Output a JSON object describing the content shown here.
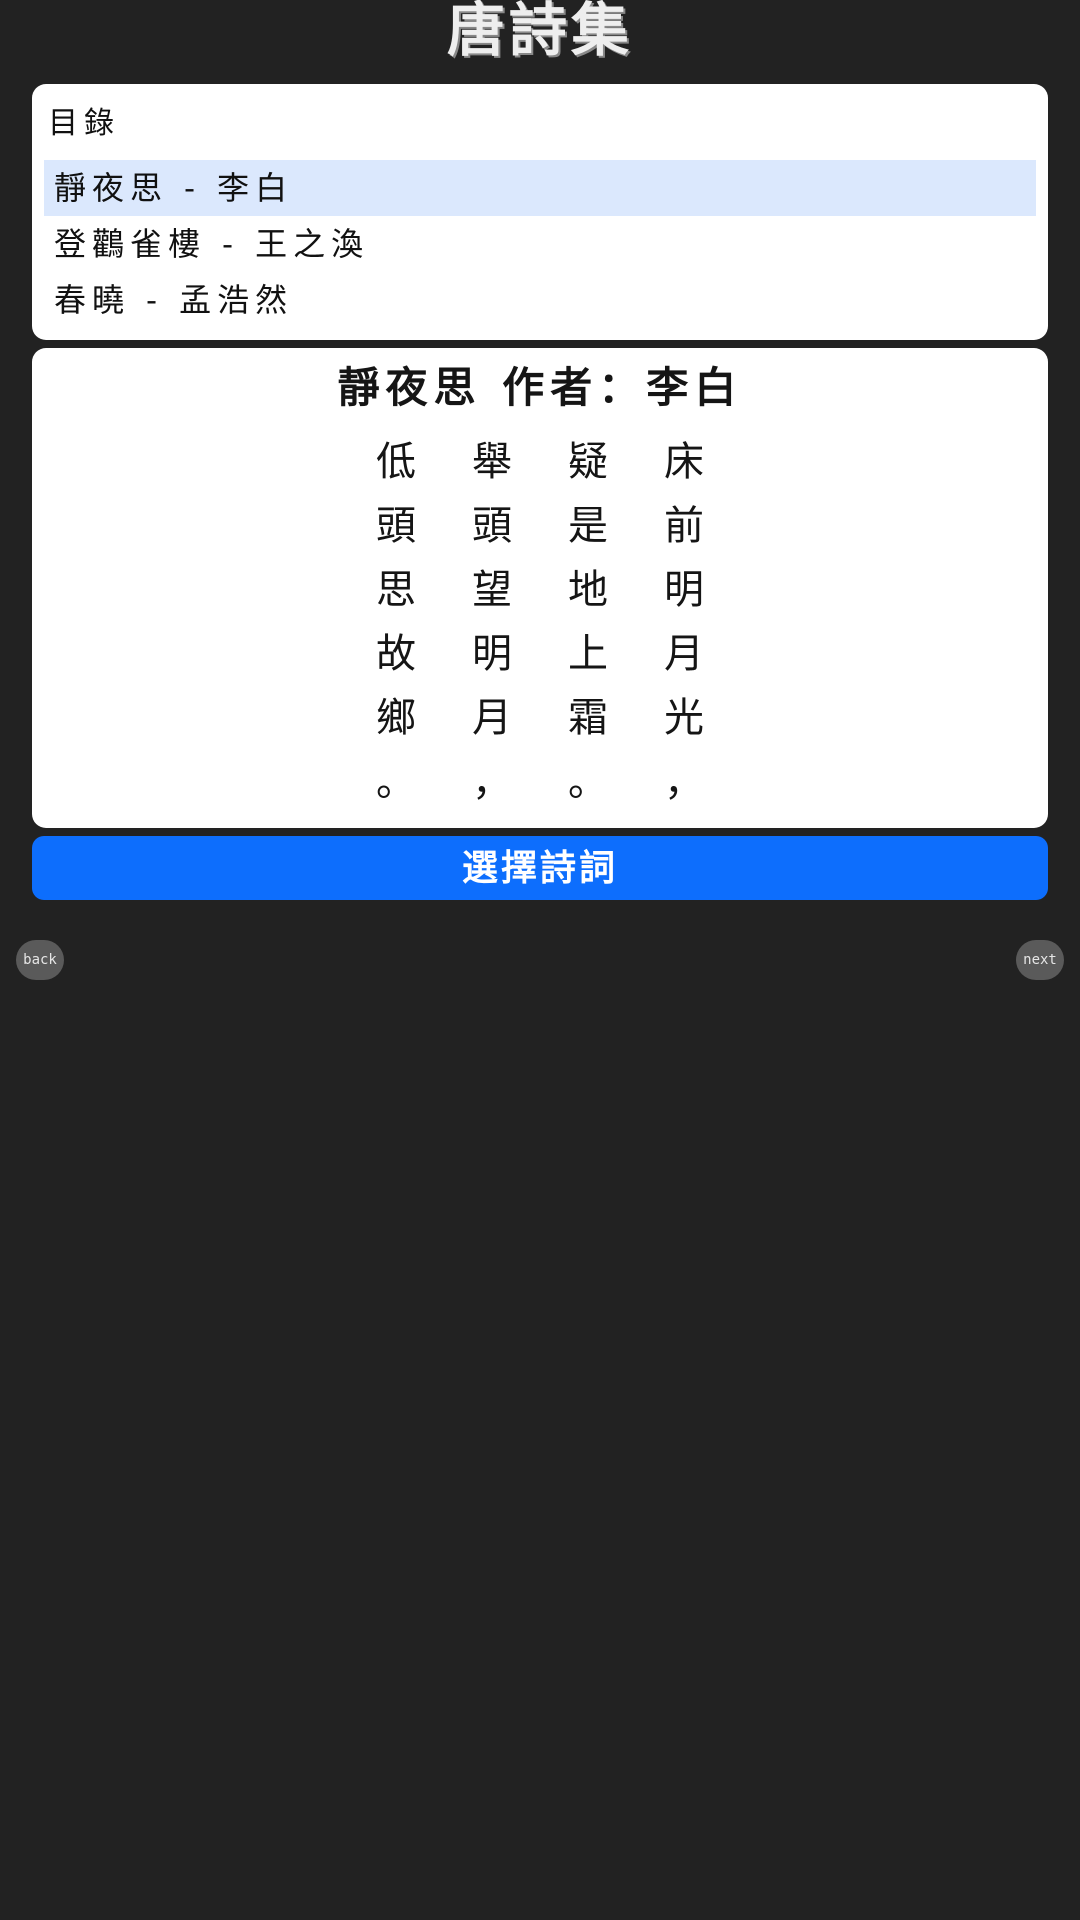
{
  "app": {
    "title": "唐詩集"
  },
  "toc": {
    "heading": "目錄",
    "items": [
      {
        "label": "靜夜思 - 李白",
        "selected": true
      },
      {
        "label": "登鸛雀樓 - 王之渙",
        "selected": false
      },
      {
        "label": "春曉 - 孟浩然",
        "selected": false
      }
    ]
  },
  "poem": {
    "title": "靜夜思",
    "author_label": "作者：",
    "author": "李白",
    "columns": [
      [
        "床",
        "前",
        "明",
        "月",
        "光",
        "，"
      ],
      [
        "疑",
        "是",
        "地",
        "上",
        "霜",
        "。"
      ],
      [
        "舉",
        "頭",
        "望",
        "明",
        "月",
        "，"
      ],
      [
        "低",
        "頭",
        "思",
        "故",
        "鄉",
        "。"
      ]
    ]
  },
  "actions": {
    "select_label": "選擇詩詞"
  },
  "nav": {
    "back_label": "back",
    "next_label": "next"
  },
  "colors": {
    "background": "#222222",
    "accent": "#0d6efd",
    "selected_row": "#dbe8fd"
  }
}
